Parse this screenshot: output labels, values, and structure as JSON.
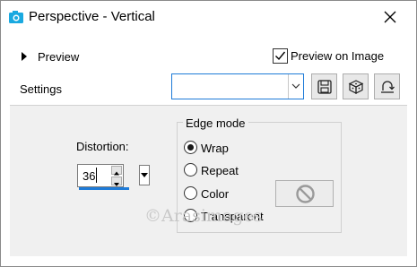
{
  "window": {
    "title": "Perspective - Vertical",
    "icon": "camera-icon",
    "close_icon": "close-icon"
  },
  "preview": {
    "toggle_label": "Preview",
    "preview_on_image_label": "Preview on Image",
    "preview_on_image_checked": true
  },
  "settings": {
    "label": "Settings",
    "selected_value": "",
    "buttons": [
      "save-preset-icon",
      "randomize-icon",
      "reset-icon"
    ]
  },
  "distortion": {
    "label": "Distortion:",
    "value": "36"
  },
  "edge_mode": {
    "title": "Edge mode",
    "options": [
      {
        "label": "Wrap",
        "selected": true
      },
      {
        "label": "Repeat",
        "selected": false
      },
      {
        "label": "Color",
        "selected": false
      },
      {
        "label": "Transparent",
        "selected": false
      }
    ],
    "color_swatch_icon": "no-color-icon"
  },
  "watermark": "©Arasimages"
}
